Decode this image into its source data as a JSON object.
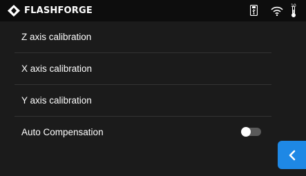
{
  "header": {
    "brand": "FLASHFORGE",
    "temperature_badge": "10"
  },
  "menu": {
    "items": [
      {
        "label": "Z axis calibration"
      },
      {
        "label": "X axis calibration"
      },
      {
        "label": "Y axis calibration"
      },
      {
        "label": "Auto Compensation",
        "toggle": "off"
      }
    ]
  },
  "colors": {
    "background": "#1b1b1b",
    "statusbar": "#0d0d0d",
    "accent": "#1e88e5",
    "divider": "#333333"
  },
  "icons": [
    "flashforge-logo-icon",
    "usb-icon",
    "wifi-icon",
    "thermometer-icon",
    "chevron-left-icon"
  ]
}
